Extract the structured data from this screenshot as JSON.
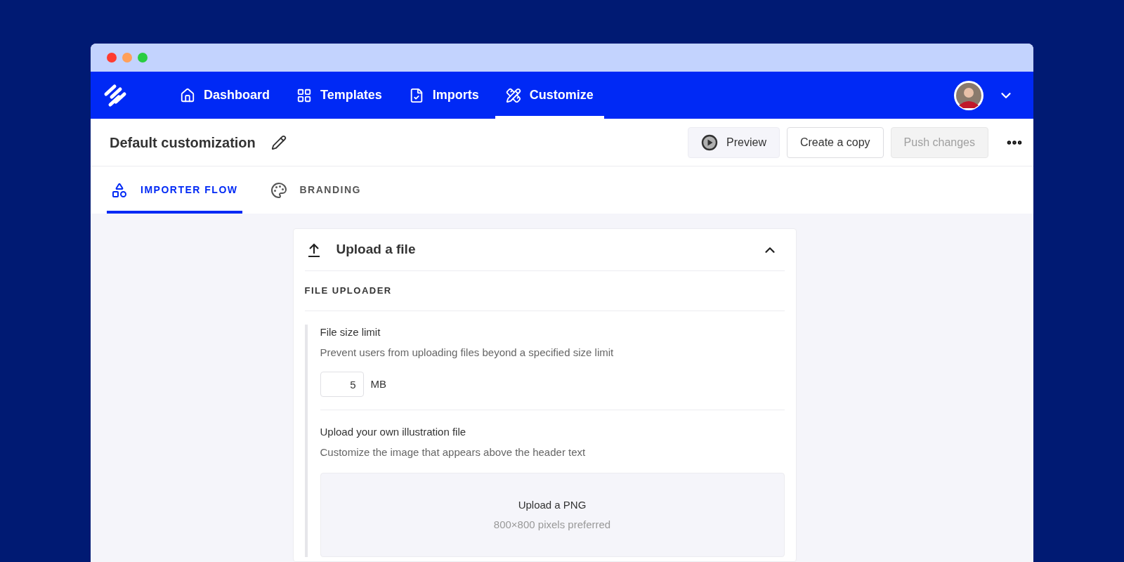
{
  "nav": {
    "items": [
      {
        "label": "Dashboard",
        "selected": false
      },
      {
        "label": "Templates",
        "selected": false
      },
      {
        "label": "Imports",
        "selected": false
      },
      {
        "label": "Customize",
        "selected": true
      }
    ]
  },
  "header": {
    "title": "Default customization",
    "buttons": [
      {
        "label": "Preview",
        "kind": "preview",
        "disabled": false
      },
      {
        "label": "Create a copy",
        "kind": "outline",
        "disabled": false
      },
      {
        "label": "Push changes",
        "kind": "outline",
        "disabled": true
      }
    ]
  },
  "tabs": [
    {
      "label": "IMPORTER FLOW",
      "selected": true
    },
    {
      "label": "BRANDING",
      "selected": false
    }
  ],
  "section": {
    "title": "Upload a file",
    "expanded": true,
    "group_title": "FILE UPLOADER",
    "size_limit": {
      "label": "File size limit",
      "description": "Prevent users from uploading files beyond a specified size limit",
      "value": "5",
      "unit": "MB"
    },
    "illustration": {
      "label": "Upload your own illustration file",
      "description": "Customize the image that appears above the header text",
      "dropzone_title": "Upload a PNG",
      "dropzone_hint": "800×800 pixels preferred"
    }
  }
}
